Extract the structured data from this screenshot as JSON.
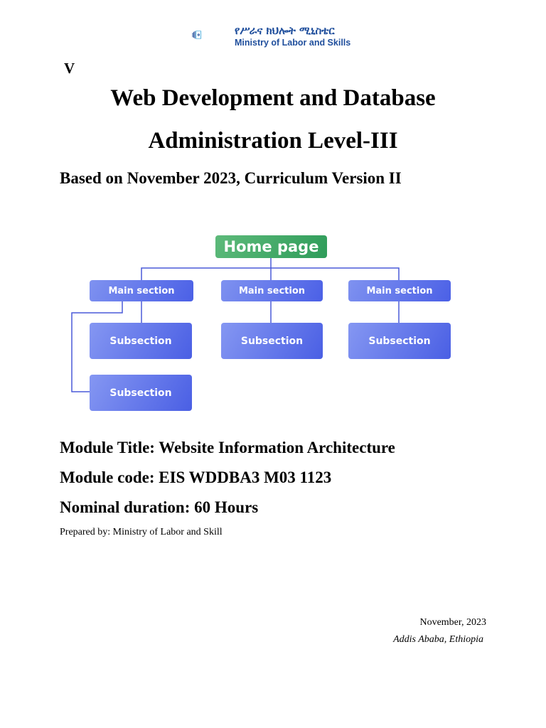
{
  "logo": {
    "amharic": "የሥራና ክህሎት ሚኒስቴር",
    "english": "Ministry of Labor and Skills"
  },
  "corner_mark": "V",
  "title_line1": "Web Development and Database",
  "title_line2": "Administration Level-III",
  "subtitle": "Based on November 2023, Curriculum Version II",
  "diagram": {
    "home": "Home page",
    "main_sections": [
      "Main section",
      "Main section",
      "Main section"
    ],
    "subsections": [
      "Subsection",
      "Subsection",
      "Subsection",
      "Subsection"
    ],
    "colors": {
      "home": "#3fa866",
      "section": "#5a6ee8",
      "line": "#4a5ad8"
    }
  },
  "module_title": "Module Title: Website Information Architecture",
  "module_code": "Module code: EIS WDDBA3 M03 1123",
  "duration": "Nominal duration: 60 Hours",
  "prepared_by": "Prepared by: Ministry of Labor and Skill",
  "date": "November, 2023",
  "place": "Addis Ababa, Ethiopia"
}
